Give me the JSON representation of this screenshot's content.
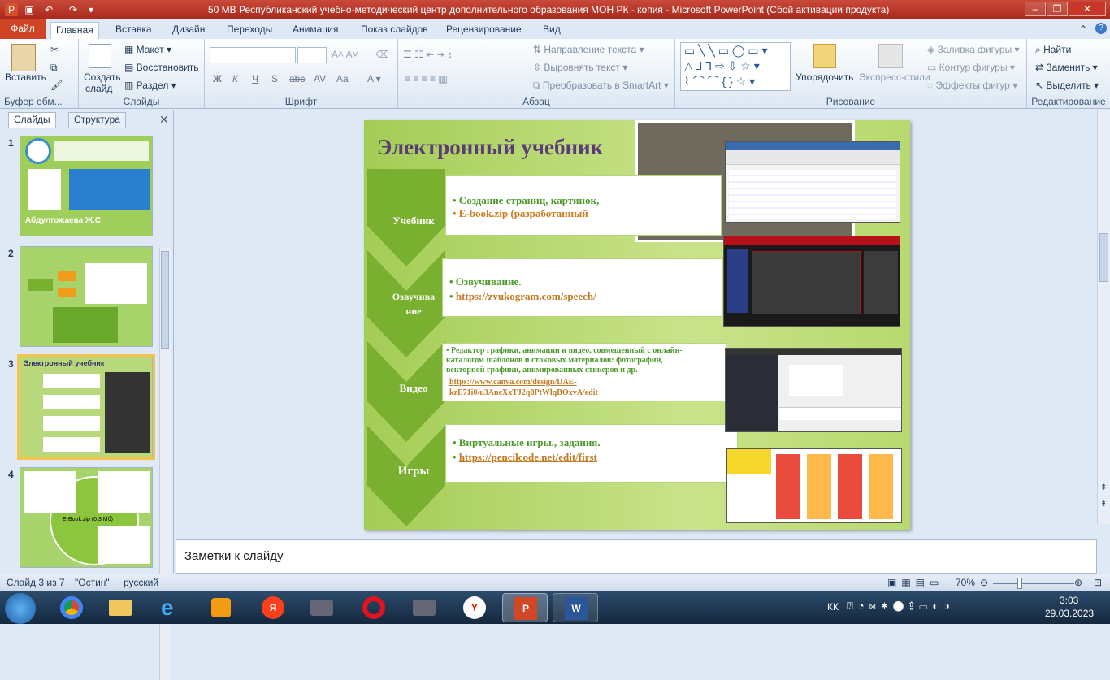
{
  "window": {
    "title": "50 МВ   Республиканский учебно-методический центр дополнительного образования МОН РК - копия  -  Microsoft PowerPoint (Сбой активации продукта)"
  },
  "tabs": [
    "Файл",
    "Главная",
    "Вставка",
    "Дизайн",
    "Переходы",
    "Анимация",
    "Показ слайдов",
    "Рецензирование",
    "Вид"
  ],
  "ribbon": {
    "clipboard": {
      "paste": "Вставить",
      "label": "Буфер обм..."
    },
    "slides": {
      "create1": "Создать",
      "create2": "слайд",
      "layout": "Макет",
      "reset": "Восстановить",
      "section": "Раздел",
      "label": "Слайды"
    },
    "font": {
      "label": "Шрифт"
    },
    "paragraph": {
      "text_dir": "Направление текста",
      "align_text": "Выровнять текст",
      "smartart": "Преобразовать в SmartArt",
      "label": "Абзац"
    },
    "drawing": {
      "arrange": "Упорядочить",
      "quick_styles": "Экспресс-стили",
      "fill": "Заливка фигуры",
      "outline": "Контур фигуры",
      "effects": "Эффекты фигур",
      "label": "Рисование"
    },
    "editing": {
      "find": "Найти",
      "replace": "Заменить",
      "select": "Выделить",
      "label": "Редактирование"
    }
  },
  "pane": {
    "tab_slides": "Слайды",
    "tab_outline": "Структура",
    "thumbs": [
      "1",
      "2",
      "3",
      "4"
    ],
    "t1": "Абдулгожаева Ж.С",
    "t3": "Электронный учебник",
    "t4": "E-Book.zip (0,3 Мб)"
  },
  "slide": {
    "title": "Электронный учебник",
    "rows": [
      {
        "label": "Учебник",
        "b1": "• Создание страниц, картинок,",
        "b2": "•  E-book.zip (разработанный"
      },
      {
        "label1": "Озвучива",
        "label2": "ние",
        "b1": "• Озвучивание.",
        "b2": "https://zvukogram.com/speech/"
      },
      {
        "label": "Видео",
        "b1": "• Редактор  графики, анимации и видео, совмещенный с     онлайн-",
        "b2": "  каталогом шаблонов и стоковых материалов: фотографий,",
        "b3": "  векторной графики, анимированных стикеров   и др.",
        "l1": "https://www.canva.com/design/DAE-",
        "l2": "kzE71i0/u3AncXxTJ2q8PtWlqBOxvA/edit"
      },
      {
        "label": "Игры",
        "b1": "• Виртуальные игры., задания.",
        "b2": "https://pencilcode.net/edit/first"
      }
    ]
  },
  "notes": {
    "placeholder": "Заметки к слайду"
  },
  "status": {
    "slide": "Слайд 3 из 7",
    "theme": "\"Остин\"",
    "lang": "русский",
    "zoom": "70%"
  },
  "taskbar": {
    "lang": "КК",
    "time": "3:03",
    "date": "29.03.2023"
  }
}
